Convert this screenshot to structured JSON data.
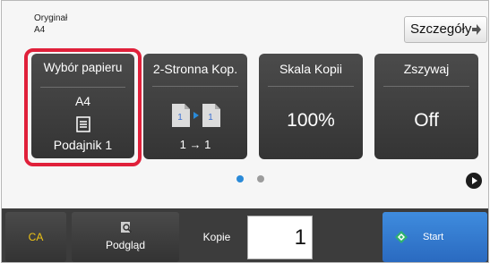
{
  "header": {
    "original_label": "Oryginał",
    "original_size": "A4",
    "details_label": "Szczegóły"
  },
  "tiles": {
    "paper": {
      "title": "Wybór papieru",
      "size": "A4",
      "tray": "Podajnik 1",
      "icon": "paper-tray-icon"
    },
    "duplex": {
      "title": "2-Stronna Kop.",
      "mode": "1 → 1",
      "icon": "duplex-copy-icon"
    },
    "scale": {
      "title": "Skala Kopii",
      "value": "100%"
    },
    "staple": {
      "title": "Zszywaj",
      "value": "Off"
    }
  },
  "pagination": {
    "current": 1,
    "total": 2
  },
  "bottom": {
    "ca_label": "CA",
    "preview_label": "Podgląd",
    "copies_label": "Kopie",
    "copies_value": "1",
    "start_label": "Start"
  },
  "colors": {
    "accent_blue": "#2a7ad0",
    "highlight_red": "#e0203a",
    "ca_yellow": "#f0c514",
    "tile_bg": "#3f3f3f"
  }
}
